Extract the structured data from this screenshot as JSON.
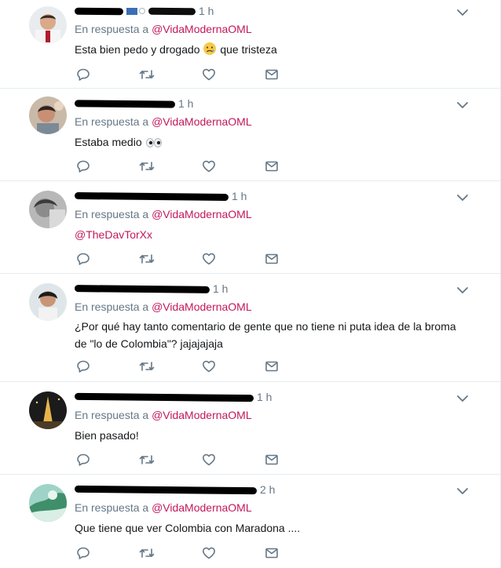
{
  "tweets": [
    {
      "time": "1 h",
      "reply_prefix": "En respuesta a",
      "reply_handle": "@VidaModernaOML",
      "text_before": "Esta bien pedo y drogado",
      "text_after": "que tristeza"
    },
    {
      "time": "1 h",
      "reply_prefix": "En respuesta a",
      "reply_handle": "@VidaModernaOML",
      "text_before": "Estaba medio"
    },
    {
      "time": "1 h",
      "reply_prefix": "En respuesta a",
      "reply_handle": "@VidaModernaOML",
      "mention": "@TheDavTorXx"
    },
    {
      "time": "1 h",
      "reply_prefix": "En respuesta a",
      "reply_handle": "@VidaModernaOML",
      "text_line1": "¿Por qué hay tanto comentario de gente que no tiene ni puta idea de la broma",
      "text_line2": "de \"lo de Colombia\"? jajajajaja"
    },
    {
      "time": "1 h",
      "reply_prefix": "En respuesta a",
      "reply_handle": "@VidaModernaOML",
      "text": "Bien pasado!"
    },
    {
      "time": "2 h",
      "reply_prefix": "En respuesta a",
      "reply_handle": "@VidaModernaOML",
      "text": "Que tiene que ver Colombia con Maradona ...."
    }
  ],
  "colors": {
    "handle": "#c2185b",
    "muted": "#657786",
    "text": "#14171a",
    "divider": "#e6ecf0"
  },
  "icons": [
    "chevron-down-icon",
    "reply-icon",
    "retweet-icon",
    "like-icon",
    "message-icon",
    "sad-face-emoji",
    "eyes-emoji"
  ]
}
